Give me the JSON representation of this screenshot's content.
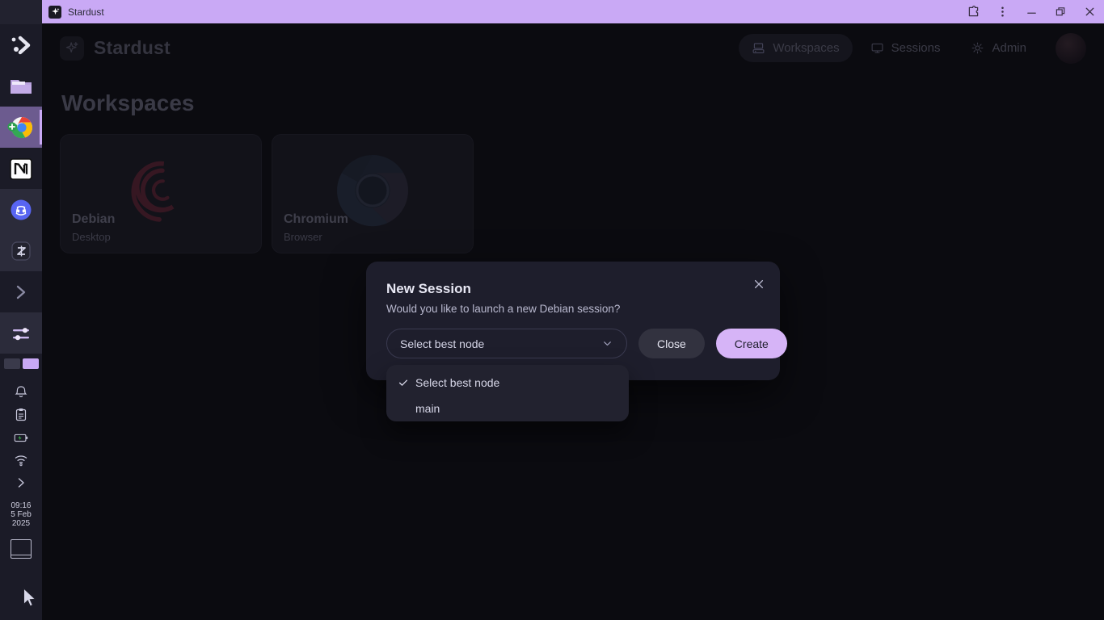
{
  "titlebar": {
    "tab_title": "Stardust",
    "favicon": "sparkle-icon",
    "extensions_icon": "puzzle-icon",
    "menu_icon": "three-dot-menu-icon",
    "minimize_icon": "minimize-icon",
    "restore_icon": "restore-icon",
    "close_icon": "close-icon",
    "background": "#c9a9f5"
  },
  "app": {
    "brand": "Stardust",
    "brand_icon": "sparkle-icon",
    "nav": [
      {
        "label": "Workspaces",
        "icon": "workspaces-icon",
        "active": true
      },
      {
        "label": "Sessions",
        "icon": "monitor-icon",
        "active": false
      },
      {
        "label": "Admin",
        "icon": "gear-icon",
        "active": false
      }
    ],
    "avatar": "user-avatar"
  },
  "main": {
    "page_title": "Workspaces",
    "cards": [
      {
        "name": "Debian",
        "type": "Desktop",
        "logo": "debian-logo"
      },
      {
        "name": "Chromium",
        "type": "Browser",
        "logo": "chromium-logo"
      }
    ]
  },
  "modal": {
    "title": "New Session",
    "description": "Would you like to launch a new Debian session?",
    "close_icon": "close-icon",
    "select_value": "Select best node",
    "select_chevron": "chevron-down-icon",
    "close_label": "Close",
    "create_label": "Create",
    "create_color": "#d6b4f7"
  },
  "dropdown": {
    "options": [
      {
        "label": "Select best node",
        "selected": true
      },
      {
        "label": "main",
        "selected": false
      }
    ],
    "check_icon": "check-icon"
  },
  "taskbar": {
    "apps": [
      {
        "name": "kde-logo",
        "active": false
      },
      {
        "name": "file-manager-icon",
        "active": false
      },
      {
        "name": "chrome-icon",
        "active": true
      },
      {
        "name": "notion-icon",
        "active": false
      },
      {
        "name": "discord-icon",
        "active": false
      },
      {
        "name": "zeal-icon",
        "active": false
      },
      {
        "name": "terminal-icon",
        "active": false
      },
      {
        "name": "settings-sliders-icon",
        "active": false
      }
    ],
    "tray": [
      "bell-icon",
      "clipboard-icon",
      "battery-icon",
      "wifi-icon",
      "chevron-right-icon"
    ],
    "pager": [
      {
        "active": false
      },
      {
        "active": true
      }
    ],
    "clock": {
      "time": "09:16",
      "day": "5 Feb",
      "year": "2025"
    },
    "window_button": "window-icon"
  },
  "cursor": "mouse-pointer"
}
